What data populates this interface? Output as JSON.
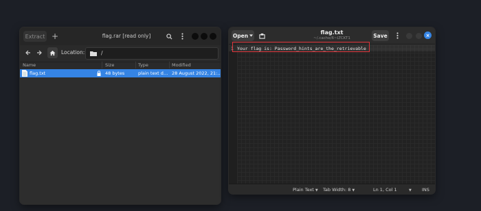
{
  "archive_window": {
    "extract_label": "Extract",
    "add_icon": "plus-icon",
    "title": "flag.rar [read only]",
    "location_label": "Location:",
    "location_value": "/",
    "columns": {
      "name": "Name",
      "size": "Size",
      "type": "Type",
      "modified": "Modified"
    },
    "files": [
      {
        "name": "flag.txt",
        "size": "48 bytes",
        "type": "plain text d…",
        "modified": "28 August 2022, 21:…"
      }
    ],
    "selection_color": "#3584e4"
  },
  "editor_window": {
    "open_label": "Open",
    "title": "flag.txt",
    "subtitle": "~/.cache/6~LTCKT1",
    "save_label": "Save",
    "line_number": "1",
    "line_text": "Your flag is: Password_hints_are_the_retrievable",
    "status": {
      "language": "Plain Text",
      "tab_width": "Tab Width: 8",
      "position": "Ln 1, Col 1",
      "mode": "INS"
    },
    "highlight_color": "#e0343a",
    "close_color": "#3584e4"
  }
}
